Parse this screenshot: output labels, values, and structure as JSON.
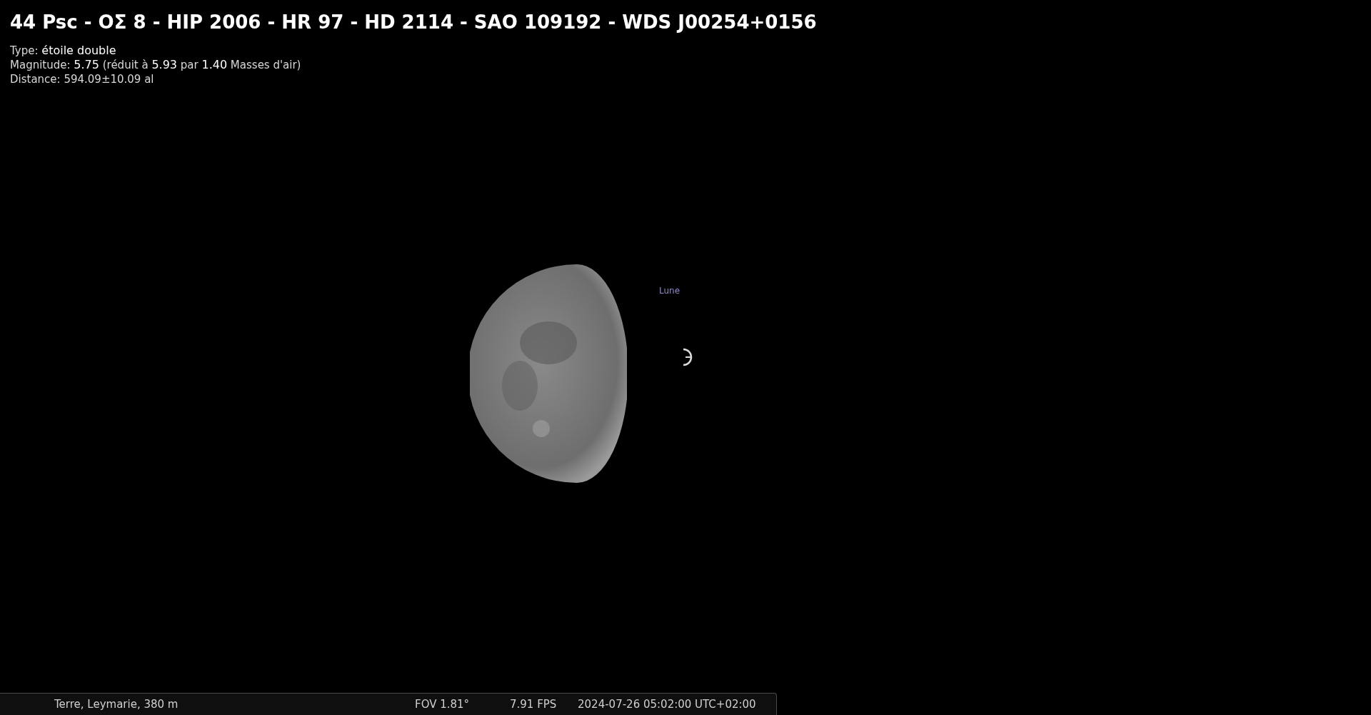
{
  "object_info": {
    "title": "44 Psc - ΟΣ 8 - HIP 2006 - HR 97 - HD 2114 - SAO 109192 - WDS J00254+0156",
    "lines": [
      "Type: **étoile double**",
      "Magnitude: **5.75** (réduit à **5.93** par **1.40** Masses d'air)",
      "Distance: 594.09±10.09 al"
    ]
  },
  "sky": {
    "moon_label": "Lune"
  },
  "status_bar": {
    "location": "Terre, Leymarie, 380 m",
    "fov": "FOV 1.81°",
    "fps": "7.91 FPS",
    "datetime": "2024-07-26 05:02:00 UTC+02:00"
  }
}
